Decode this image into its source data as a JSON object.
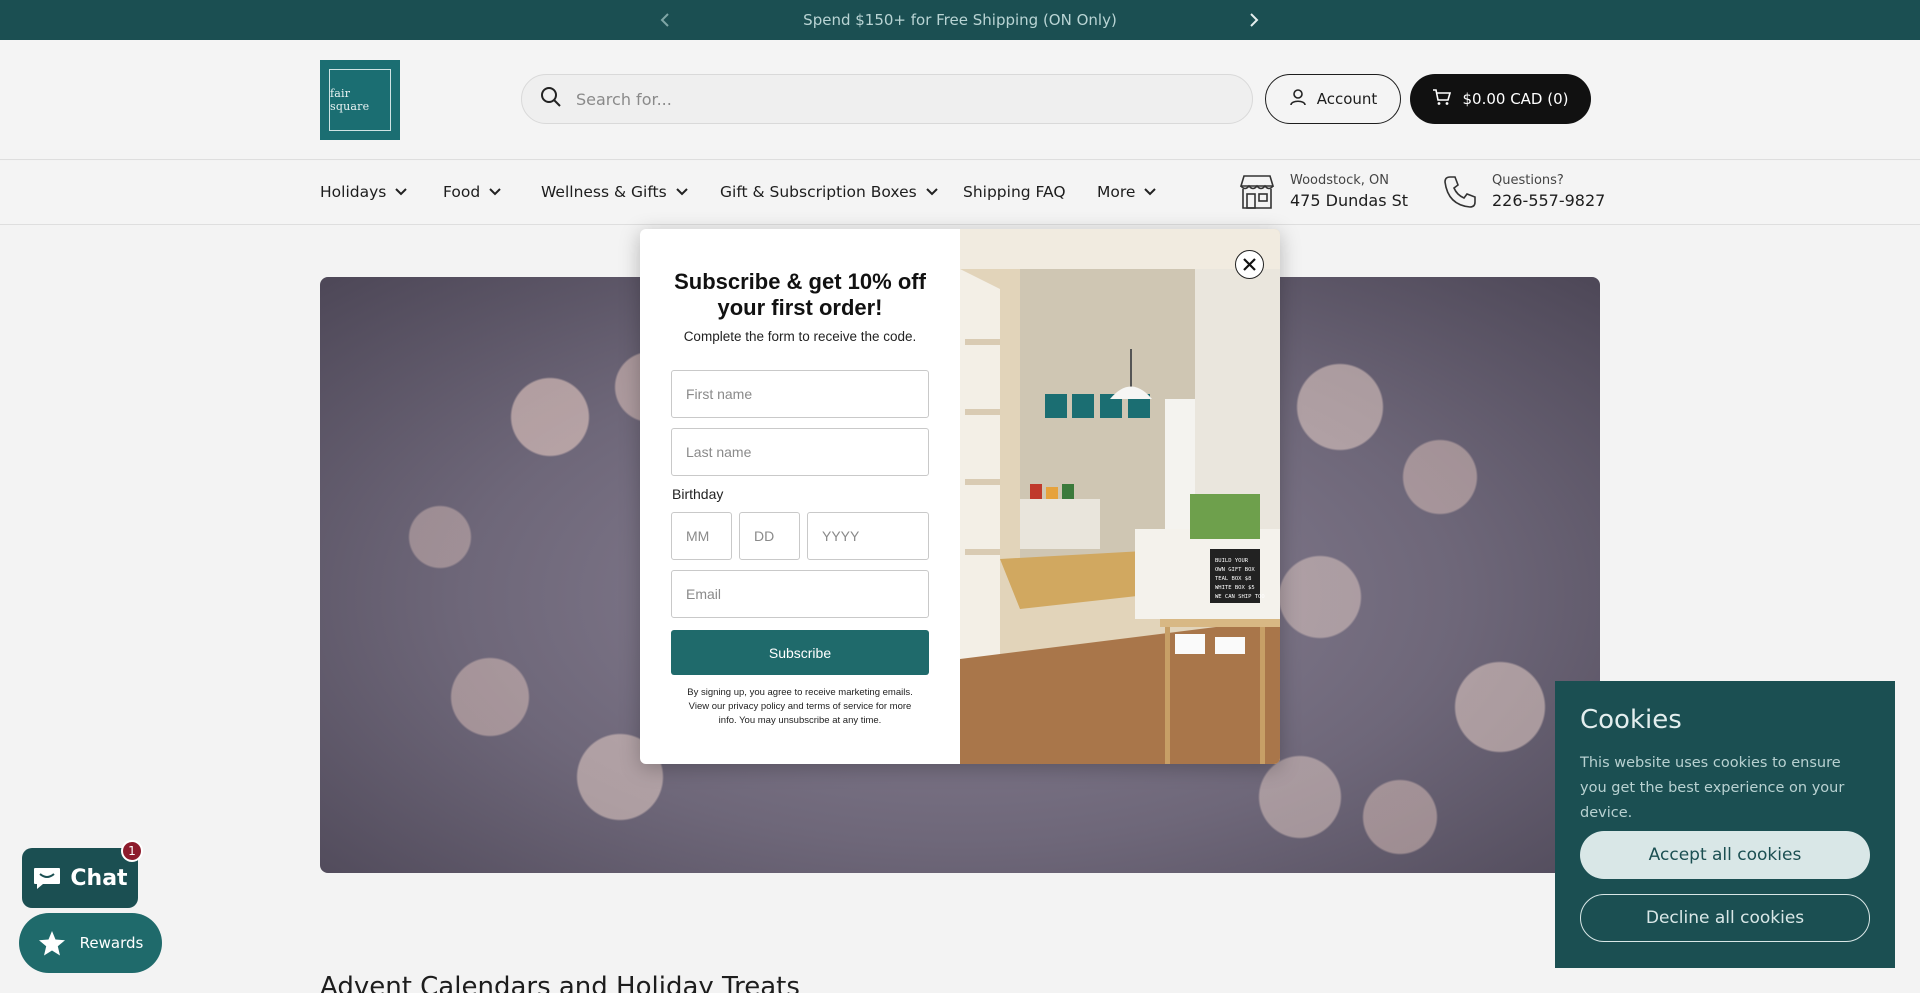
{
  "announcement": {
    "text": "Spend $150+ for Free Shipping (ON Only)"
  },
  "header": {
    "logo_text": "fair square",
    "search_placeholder": "Search for...",
    "account_label": "Account",
    "cart_label": "$0.00 CAD (0)"
  },
  "nav": {
    "items": [
      {
        "label": "Holidays"
      },
      {
        "label": "Food"
      },
      {
        "label": "Wellness & Gifts"
      },
      {
        "label": "Gift & Subscription Boxes"
      },
      {
        "label": "Shipping FAQ"
      },
      {
        "label": "More"
      }
    ],
    "store": {
      "city": "Woodstock, ON",
      "address": "475 Dundas St"
    },
    "phone": {
      "label": "Questions?",
      "number": "226-557-9827"
    }
  },
  "hero": {
    "section_title": "Advent Calendars and Holiday Treats"
  },
  "popup": {
    "title": "Subscribe & get 10% off your first order!",
    "subtitle": "Complete the form to receive the code.",
    "first_name_placeholder": "First name",
    "last_name_placeholder": "Last name",
    "birthday_label": "Birthday",
    "mm_placeholder": "MM",
    "dd_placeholder": "DD",
    "yyyy_placeholder": "YYYY",
    "email_placeholder": "Email",
    "subscribe_label": "Subscribe",
    "legal": "By signing up, you agree to receive marketing emails. View our privacy policy and terms of service for more info. You may unsubscribe at any time.",
    "sign_text": "BUILD YOUR OWN GIFT BOX TEAL BOX $8 WHITE BOX $5 WE CAN SHIP TOO"
  },
  "cookies": {
    "title": "Cookies",
    "text": "This website uses cookies to ensure you get the best experience on your device.",
    "accept_label": "Accept all cookies",
    "decline_label": "Decline all cookies"
  },
  "chat": {
    "label": "Chat",
    "badge": "1"
  },
  "rewards": {
    "label": "Rewards"
  },
  "colors": {
    "brand": "#1b4f52",
    "accent": "#1f6a6b",
    "badge": "#8d1b2c"
  }
}
